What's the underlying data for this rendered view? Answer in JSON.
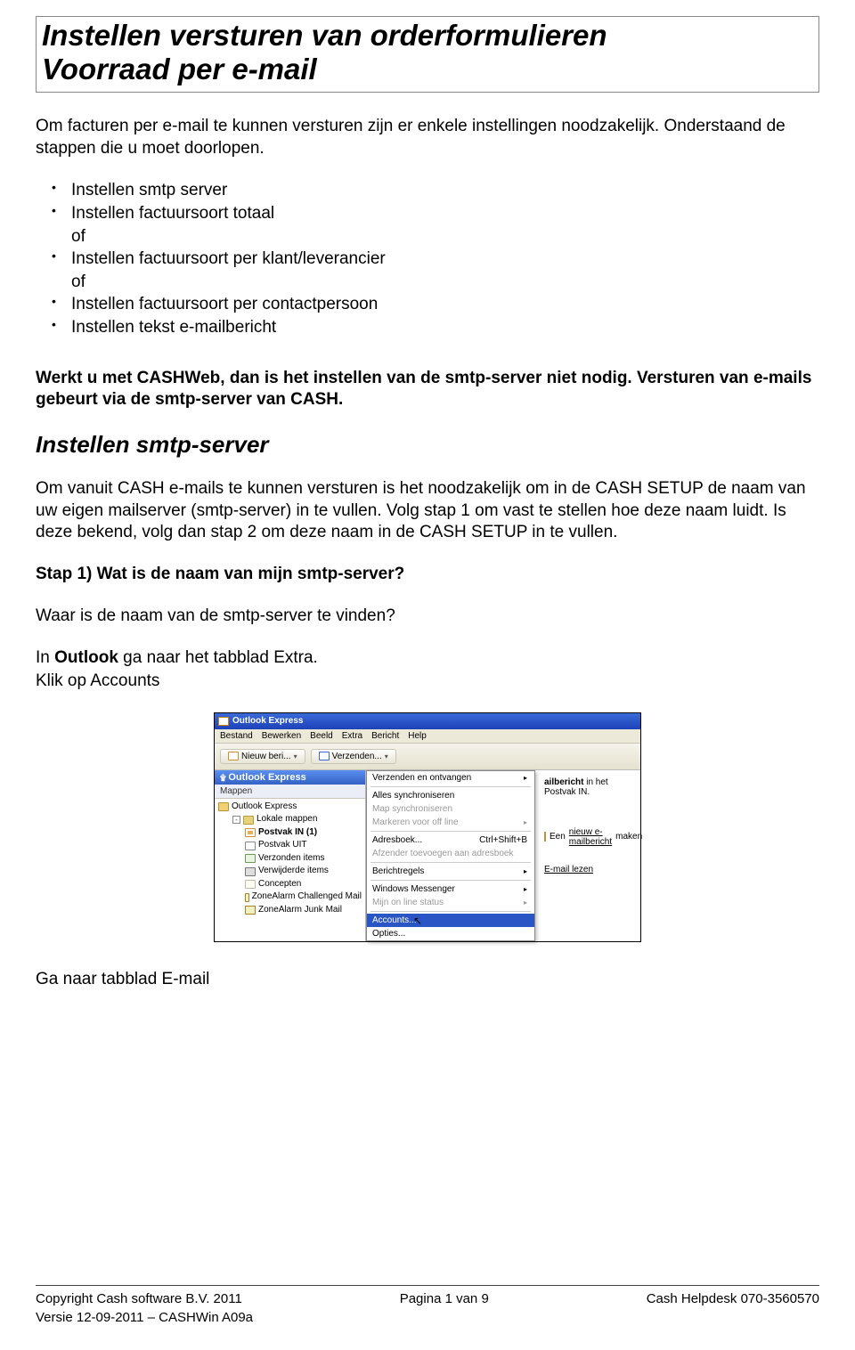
{
  "title": {
    "line1": "Instellen versturen van orderformulieren",
    "line2": "Voorraad per e-mail"
  },
  "intro": "Om facturen per e-mail te kunnen versturen zijn er enkele instellingen noodzakelijk. Onderstaand de stappen die u moet doorlopen.",
  "steps": {
    "s1": "Instellen smtp server",
    "s2": "Instellen factuursoort totaal",
    "of": "of",
    "s3": "Instellen factuursoort per klant/leverancier",
    "s4": "Instellen factuursoort per contactpersoon",
    "s5": "Instellen tekst e-mailbericht"
  },
  "note": "Werkt u met CASHWeb, dan is het instellen van de smtp-server niet nodig. Versturen van e-mails gebeurt via de smtp-server van CASH.",
  "section_heading": "Instellen smtp-server",
  "section_para": "Om vanuit CASH e-mails te kunnen versturen is het noodzakelijk om in de CASH SETUP de naam van uw eigen mailserver (smtp-server) in te vullen. Volg stap 1 om vast te stellen hoe deze naam luidt. Is deze bekend, volg dan stap 2 om deze naam in de CASH SETUP in te vullen.",
  "stap1_heading": "Stap 1) Wat is de naam van mijn smtp-server?",
  "stap1_q": "Waar is de naam van de smtp-server te vinden?",
  "outlook_pre": "In ",
  "outlook_word": "Outlook",
  "outlook_post": " ga naar het tabblad Extra.",
  "outlook_line2": "Klik op Accounts",
  "after_screenshot": "Ga naar tabblad E-mail",
  "screenshot": {
    "window_title": "Outlook Express",
    "menubar": [
      "Bestand",
      "Bewerken",
      "Beeld",
      "Extra",
      "Bericht",
      "Help"
    ],
    "toolbar": {
      "btn1": "Nieuw beri...",
      "btn2": "Verzenden..."
    },
    "left_header": "Outlook Express",
    "left_sub": "Mappen",
    "tree": {
      "root": "Outlook Express",
      "local": "Lokale mappen",
      "inbox": "Postvak IN (1)",
      "outbox": "Postvak UIT",
      "sent": "Verzonden items",
      "deleted": "Verwijderde items",
      "drafts": "Concepten",
      "za1": "ZoneAlarm Challenged Mail",
      "za2": "ZoneAlarm Junk Mail"
    },
    "dropdown": {
      "d1": "Verzenden en ontvangen",
      "d2": "Alles synchroniseren",
      "d3": "Map synchroniseren",
      "d4": "Markeren voor off line",
      "d5": "Adresboek...",
      "d5_short": "Ctrl+Shift+B",
      "d6": "Afzender toevoegen aan adresboek",
      "d7": "Berichtregels",
      "d8": "Windows Messenger",
      "d9": "Mijn on line status",
      "d10": "Accounts...",
      "d11": "Opties..."
    },
    "right_text1_suffix": " in het Postvak IN.",
    "right_text1_bold": "ailbericht",
    "right_text2_pre": "Een ",
    "right_text2_link": "nieuw e-mailbericht",
    "right_text2_post": " maken",
    "right_text3": "E-mail lezen"
  },
  "footer": {
    "left1": "Copyright Cash software B.V. 2011",
    "center": "Pagina 1 van 9",
    "right": "Cash Helpdesk 070-3560570",
    "left2": "Versie 12-09-2011 – CASHWin A09a"
  }
}
